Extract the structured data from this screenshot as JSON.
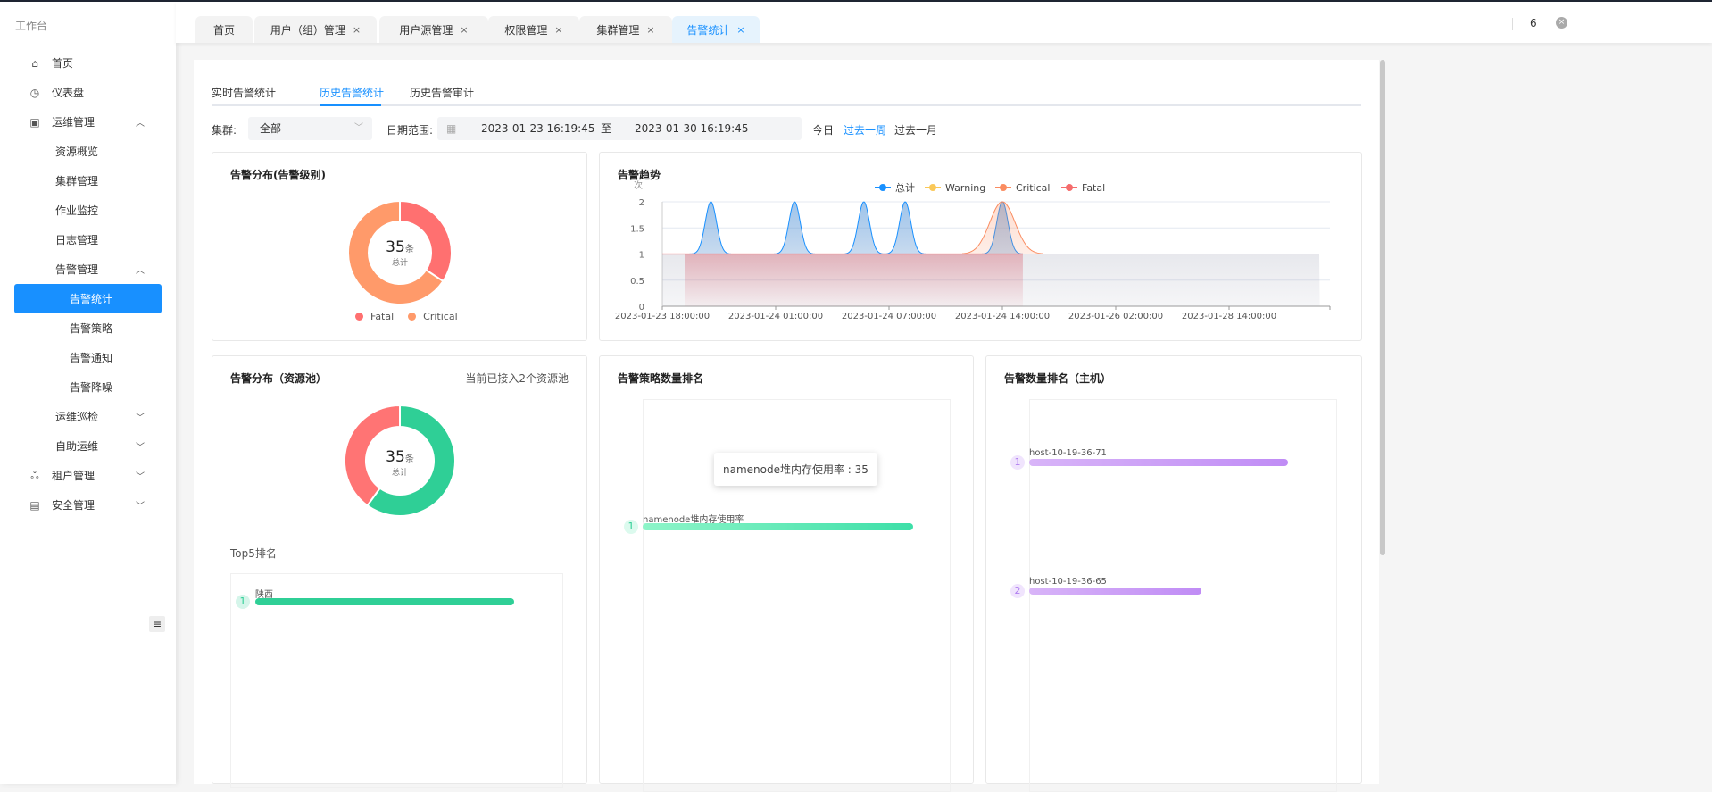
{
  "sidebar": {
    "workspace": "工作台",
    "items": [
      {
        "label": "首页",
        "icon": "home-icon",
        "level": 0
      },
      {
        "label": "仪表盘",
        "icon": "dashboard-icon",
        "level": 0
      },
      {
        "label": "运维管理",
        "icon": "ops-icon",
        "level": 0,
        "expanded": true
      },
      {
        "label": "资源概览",
        "level": 1
      },
      {
        "label": "集群管理",
        "level": 1
      },
      {
        "label": "作业监控",
        "level": 1
      },
      {
        "label": "日志管理",
        "level": 1
      },
      {
        "label": "告警管理",
        "level": 1,
        "expanded": true
      },
      {
        "label": "告警统计",
        "level": 2,
        "active": true
      },
      {
        "label": "告警策略",
        "level": 2
      },
      {
        "label": "告警通知",
        "level": 2
      },
      {
        "label": "告警降噪",
        "level": 2
      },
      {
        "label": "运维巡检",
        "level": 1,
        "expanded": false
      },
      {
        "label": "自助运维",
        "level": 1,
        "expanded": false
      },
      {
        "label": "租户管理",
        "icon": "tenant-icon",
        "level": 0,
        "expanded": false
      },
      {
        "label": "安全管理",
        "icon": "security-icon",
        "level": 0,
        "expanded": false
      }
    ]
  },
  "tabs": [
    {
      "label": "首页",
      "closable": false
    },
    {
      "label": "用户（组）管理",
      "closable": true
    },
    {
      "label": "用户源管理",
      "closable": true
    },
    {
      "label": "权限管理",
      "closable": true
    },
    {
      "label": "集群管理",
      "closable": true
    },
    {
      "label": "告警统计",
      "closable": true,
      "active": true
    }
  ],
  "tab_count": "6",
  "close_symbol": "×",
  "subtabs": [
    {
      "label": "实时告警统计"
    },
    {
      "label": "历史告警统计",
      "active": true
    },
    {
      "label": "历史告警审计"
    }
  ],
  "filters": {
    "cluster_label": "集群:",
    "cluster_value": "全部",
    "date_label": "日期范围:",
    "date_start": "2023-01-23 16:19:45",
    "date_sep": "至",
    "date_end": "2023-01-30 16:19:45",
    "quick": [
      {
        "label": "今日"
      },
      {
        "label": "过去一周",
        "active": true
      },
      {
        "label": "过去一月"
      }
    ]
  },
  "level_card": {
    "title": "告警分布(告警级别)",
    "total": "35",
    "unit": "条",
    "total_label": "总计"
  },
  "pool_card": {
    "title": "告警分布（资源池）",
    "note": "当前已接入2个资源池",
    "total": "35",
    "unit": "条",
    "total_label": "总计",
    "top_title": "Top5排名",
    "top": [
      {
        "rank": "1",
        "name": "陕西",
        "value": 21
      }
    ]
  },
  "strategy_card": {
    "title": "告警策略数量排名",
    "tooltip": "namenode堆内存使用率 : 35",
    "items": [
      {
        "rank": "1",
        "name": "namenode堆内存使用率",
        "value": 35
      }
    ]
  },
  "host_card": {
    "title": "告警数量排名（主机）",
    "items": [
      {
        "rank": "1",
        "name": "host-10-19-36-71",
        "value": 22
      },
      {
        "rank": "2",
        "name": "host-10-19-36-65",
        "value": 13
      }
    ]
  },
  "colors": {
    "accent": "#1890ff",
    "fatal": "#f56c6c",
    "critical": "#fa8c60",
    "warning": "#fac858",
    "total": "#1890ff",
    "green": "#2fcf96",
    "purple": "#c18cf5"
  },
  "chart_data": [
    {
      "type": "pie",
      "title": "告警分布(告警级别)",
      "series": [
        {
          "name": "Fatal",
          "value": 12,
          "color": "#ff7070"
        },
        {
          "name": "Critical",
          "value": 23,
          "color": "#ff9a6a"
        }
      ],
      "legend": "bottom"
    },
    {
      "type": "pie",
      "title": "告警分布（资源池）",
      "series": [
        {
          "value": 21,
          "color": "#2fcf96"
        },
        {
          "value": 14,
          "color": "#ff7474"
        }
      ]
    },
    {
      "type": "area",
      "title": "告警趋势",
      "ylabel": "次",
      "ylim": [
        0,
        2
      ],
      "yticks": [
        "0",
        "0.5",
        "1",
        "1.5",
        "2"
      ],
      "grid": true,
      "legend": "top-right",
      "xticks": [
        "2023-01-23 18:00:00",
        "2023-01-24 01:00:00",
        "2023-01-24 07:00:00",
        "2023-01-24 14:00:00",
        "2023-01-26 02:00:00",
        "2023-01-28 14:00:00"
      ],
      "series": [
        {
          "name": "总计",
          "color": "#1890ff",
          "baseline": 1,
          "range": [
            "2023-01-23 18:00",
            "2023-01-30 14:00"
          ],
          "peaks": [
            {
              "t": "2023-01-23 21:00",
              "v": 2
            },
            {
              "t": "2023-01-24 02:00",
              "v": 2
            },
            {
              "t": "2023-01-24 05:40",
              "v": 2
            },
            {
              "t": "2023-01-24 08:00",
              "v": 2
            },
            {
              "t": "2023-01-24 14:00",
              "v": 2
            }
          ]
        },
        {
          "name": "Warning",
          "color": "#fac858",
          "peaks": []
        },
        {
          "name": "Critical",
          "color": "#fa8c60",
          "baseline": null,
          "peaks": [
            {
              "t": "2023-01-24 14:00",
              "v": 2
            }
          ]
        },
        {
          "name": "Fatal",
          "color": "#f56c6c",
          "baseline": 1,
          "range": [
            "2023-01-23 18:00",
            "2023-01-24 20:30"
          ],
          "peaks": []
        }
      ]
    }
  ]
}
